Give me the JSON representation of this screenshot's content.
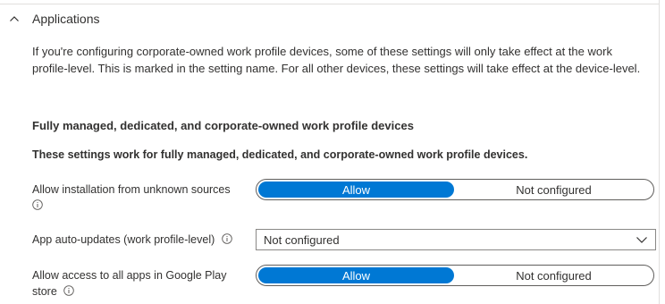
{
  "section": {
    "title": "Applications",
    "collapse_icon": "chevron-up-icon",
    "description": "If you're configuring corporate-owned work profile devices, some of these settings will only take effect at the work profile-level. This is marked in the setting name. For all other devices, these settings will take effect at the device-level."
  },
  "group": {
    "heading": "Fully managed, dedicated, and corporate-owned work profile devices",
    "description": "These settings work for fully managed, dedicated, and corporate-owned work profile devices."
  },
  "settings": [
    {
      "label": "Allow installation from unknown sources",
      "info_icon": "info-icon",
      "type": "toggle",
      "options": [
        "Allow",
        "Not configured"
      ],
      "selected": "Allow"
    },
    {
      "label": "App auto-updates (work profile-level)",
      "info_icon": "info-icon",
      "type": "dropdown",
      "value": "Not configured",
      "dropdown_icon": "chevron-down-icon"
    },
    {
      "label": "Allow access to all apps in Google Play store",
      "info_icon": "info-icon",
      "type": "toggle",
      "options": [
        "Allow",
        "Not configured"
      ],
      "selected": "Allow"
    }
  ],
  "colors": {
    "accent": "#0078d4",
    "text": "#323130",
    "border": "#8a8886"
  }
}
